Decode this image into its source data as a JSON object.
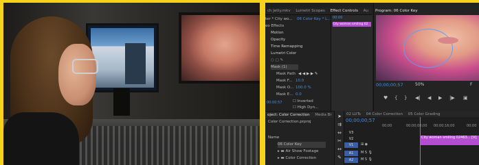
{
  "effect_panel": {
    "tabs": [
      "ch Jetty.mkv",
      "Lumetri Scopes",
      "Effect Controls",
      "Au"
    ],
    "source": "ter * City wo...",
    "clip_name": "06 Color Key * L...",
    "tc_top": "00:00",
    "section": "eo Effects",
    "effects": [
      "Motion",
      "Opacity",
      "Time Remapping",
      "Lumetri Color"
    ],
    "mask_label": "Mask (1)",
    "mask_path": "Mask Path",
    "mask_feather_label": "Mask F...",
    "mask_feather_value": "10.0",
    "mask_opacity_label": "Mask O...",
    "mask_opacity_value": "100.0 %",
    "mask_expansion_label": "Mask E...",
    "mask_expansion_value": "0.0",
    "inverted": "Inverted",
    "high_dynamic": "High Dyn...",
    "clip_tooltip": "City woman smiling 02",
    "tc_bottom": "00:00:57"
  },
  "program": {
    "title": "Program: 06 Color Key",
    "timecode": "00;00;00;57",
    "zoom": "50%",
    "zoom_right": "F"
  },
  "project": {
    "tabs": [
      "oject: Color Correction",
      "Media Br"
    ],
    "file": "Color Correction.prproj",
    "column_header": "Name",
    "rows": [
      "06 Color Key",
      "Air Show Footage",
      "Color Correction",
      "..."
    ]
  },
  "sequence": {
    "tabs": [
      "02 LUTs",
      "04 Color Correction",
      "05 Color Grading"
    ],
    "timecode": "00;00;00;57",
    "ruler": [
      "00;00",
      "00;00;08;00",
      "00;00;16;00",
      "00;00"
    ],
    "tracks": [
      "V3",
      "V2",
      "V1",
      "A1",
      "A2"
    ],
    "clip_label": "City woman smiling 02463... [V]"
  },
  "colors": {
    "accent_blue": "#4a8fe0",
    "clip_purple": "#b34dd1",
    "frame_yellow": "#f6d21c"
  }
}
